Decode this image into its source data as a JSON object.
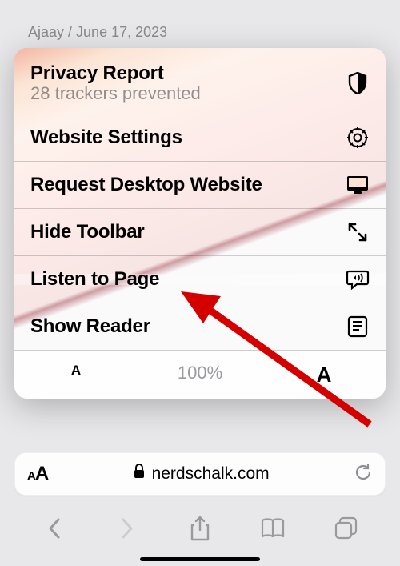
{
  "byline": {
    "author": "Ajaay",
    "sep": " / ",
    "date": "June 17, 2023"
  },
  "menu": {
    "privacy": {
      "title": "Privacy Report",
      "sub": "28 trackers prevented"
    },
    "website_settings": "Website Settings",
    "desktop": "Request Desktop Website",
    "hide_toolbar": "Hide Toolbar",
    "listen": "Listen to Page",
    "reader": "Show Reader"
  },
  "zoom": {
    "small": "A",
    "level": "100%",
    "big": "A"
  },
  "address": {
    "domain": "nerdschalk.com"
  }
}
